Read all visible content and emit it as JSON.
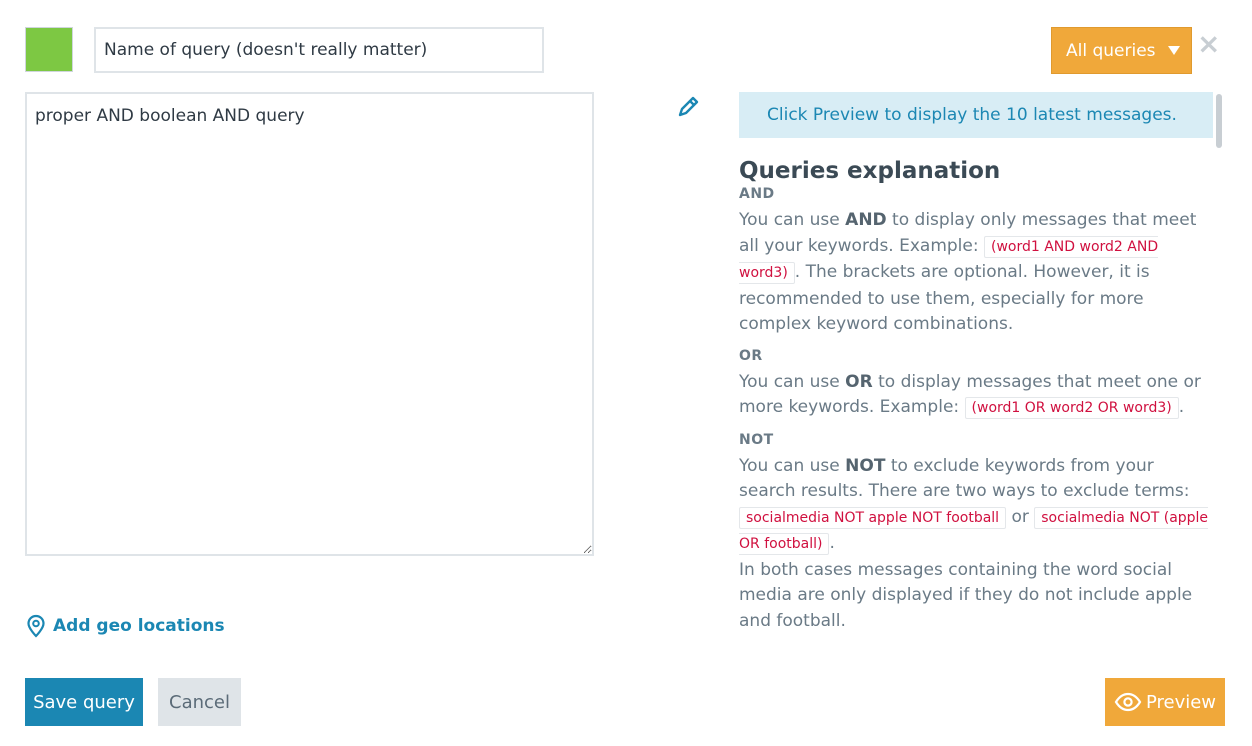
{
  "header": {
    "color_swatch": "#7dc843",
    "name_placeholder": "Name of query (doesn't really matter)",
    "all_queries_label": "All queries",
    "close_label": "×"
  },
  "query": {
    "value": "proper AND boolean AND query"
  },
  "geo": {
    "label": "Add geo locations"
  },
  "info": {
    "text": "Click Preview to display the 10 latest messages."
  },
  "explanation": {
    "title": "Queries explanation",
    "and_head": "AND",
    "and_pre": "You can use ",
    "and_kw": "AND",
    "and_mid": " to display only messages that meet all your keywords. Example: ",
    "and_code": "(word1 AND word2 AND word3)",
    "and_post": ". The brackets are optional. However, it is recommended to use them, especially for more complex keyword combinations.",
    "or_head": "OR",
    "or_pre": "You can use ",
    "or_kw": "OR",
    "or_mid": " to display messages that meet one or more keywords. Example: ",
    "or_code": "(word1 OR word2 OR word3)",
    "or_post": ".",
    "not_head": "NOT",
    "not_pre": "You can use ",
    "not_kw": "NOT",
    "not_mid": " to exclude keywords from your search results. There are two ways to exclude terms: ",
    "not_code1": "socialmedia NOT apple NOT football",
    "not_or": " or ",
    "not_code2": "socialmedia NOT (apple OR football)",
    "not_post": ".",
    "not_para2": "In both cases messages containing the word social media are only displayed if they do not include apple and football."
  },
  "footer": {
    "save_label": "Save query",
    "cancel_label": "Cancel",
    "preview_label": "Preview"
  },
  "colors": {
    "primary": "#1b87b3",
    "accent": "#f0a83a",
    "code": "#d0103f"
  }
}
